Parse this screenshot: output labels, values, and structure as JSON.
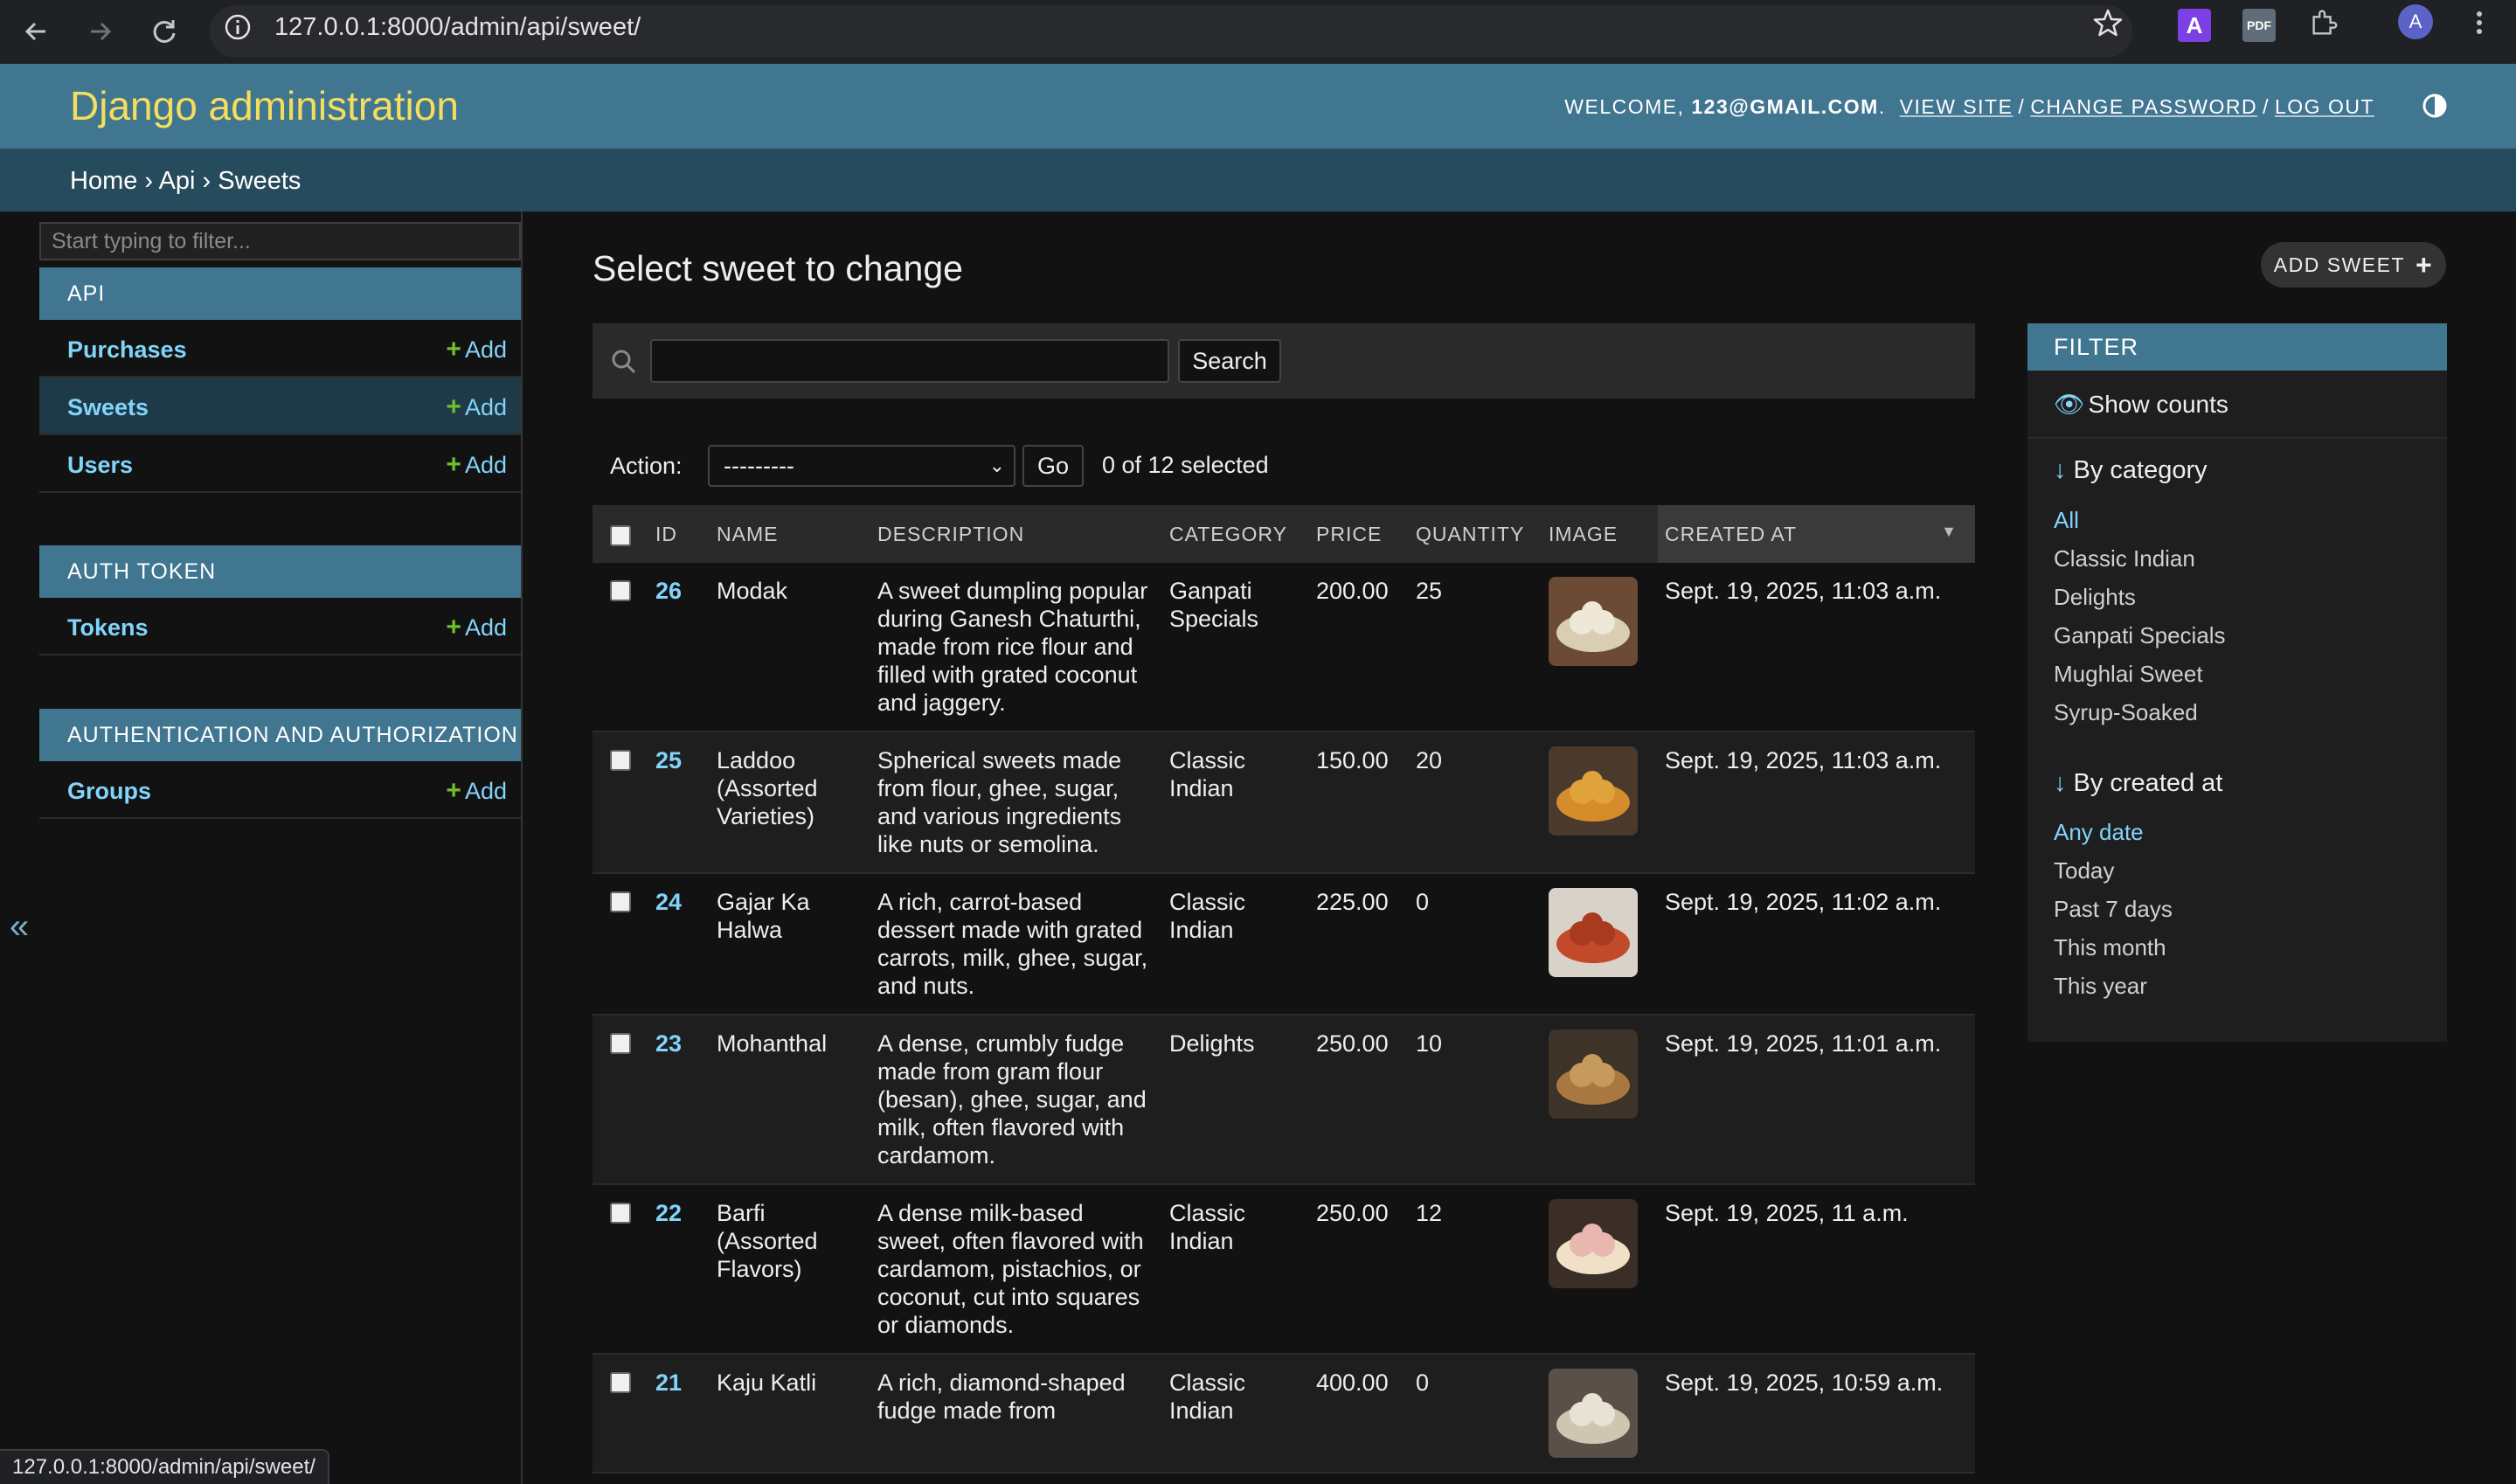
{
  "browser": {
    "url": "127.0.0.1:8000/admin/api/sweet/",
    "avatar_letter": "A",
    "ext_a_label": "A",
    "ext_pdf_label": "PDF",
    "status_url": "127.0.0.1:8000/admin/api/sweet/"
  },
  "header": {
    "site_name": "Django administration",
    "welcome": "WELCOME, ",
    "user": "123@GMAIL.COM",
    "period": ".",
    "view_site": "VIEW SITE",
    "change_password": "CHANGE PASSWORD",
    "log_out": "LOG OUT",
    "separator": "/"
  },
  "breadcrumbs": {
    "home": "Home",
    "app": "Api",
    "current": "Sweets",
    "sep": "›"
  },
  "sidebar": {
    "filter_placeholder": "Start typing to filter...",
    "add_label": "Add",
    "collapse_icon": "«",
    "modules": [
      {
        "caption": "API",
        "models": [
          "Purchases",
          "Sweets",
          "Users"
        ]
      },
      {
        "caption": "AUTH TOKEN",
        "models": [
          "Tokens"
        ]
      },
      {
        "caption": "AUTHENTICATION AND AUTHORIZATION",
        "models": [
          "Groups"
        ]
      }
    ],
    "current_model": "Sweets"
  },
  "content": {
    "title": "Select sweet to change",
    "add_button": "ADD SWEET",
    "search_button": "Search",
    "action_label": "Action:",
    "action_selected": "---------",
    "go_button": "Go",
    "selected_count": "0 of 12 selected",
    "columns": [
      "ID",
      "NAME",
      "DESCRIPTION",
      "CATEGORY",
      "PRICE",
      "QUANTITY",
      "IMAGE",
      "CREATED AT"
    ],
    "rows": [
      {
        "id": "26",
        "name": "Modak",
        "description": "A sweet dumpling popular during Ganesh Chaturthi, made from rice flour and filled with grated coconut and jaggery.",
        "category": "Ganpati Specials",
        "price": "200.00",
        "quantity": "25",
        "created_at": "Sept. 19, 2025, 11:03 a.m."
      },
      {
        "id": "25",
        "name": "Laddoo (Assorted Varieties)",
        "description": "Spherical sweets made from flour, ghee, sugar, and various ingredients like nuts or semolina.",
        "category": "Classic Indian",
        "price": "150.00",
        "quantity": "20",
        "created_at": "Sept. 19, 2025, 11:03 a.m."
      },
      {
        "id": "24",
        "name": "Gajar Ka Halwa",
        "description": "A rich, carrot-based dessert made with grated carrots, milk, ghee, sugar, and nuts.",
        "category": "Classic Indian",
        "price": "225.00",
        "quantity": "0",
        "created_at": "Sept. 19, 2025, 11:02 a.m."
      },
      {
        "id": "23",
        "name": "Mohanthal",
        "description": "A dense, crumbly fudge made from gram flour (besan), ghee, sugar, and milk, often flavored with cardamom.",
        "category": "Delights",
        "price": "250.00",
        "quantity": "10",
        "created_at": "Sept. 19, 2025, 11:01 a.m."
      },
      {
        "id": "22",
        "name": "Barfi (Assorted Flavors)",
        "description": "A dense milk-based sweet, often flavored with cardamom, pistachios, or coconut, cut into squares or diamonds.",
        "category": "Classic Indian",
        "price": "250.00",
        "quantity": "12",
        "created_at": "Sept. 19, 2025, 11 a.m."
      },
      {
        "id": "21",
        "name": "Kaju Katli",
        "description": "A rich, diamond-shaped fudge made from",
        "category": "Classic Indian",
        "price": "400.00",
        "quantity": "0",
        "created_at": "Sept. 19, 2025, 10:59 a.m."
      }
    ]
  },
  "filter": {
    "caption": "FILTER",
    "show_counts": "Show counts",
    "by_category": "By category",
    "category_choices": [
      "All",
      "Classic Indian",
      "Delights",
      "Ganpati Specials",
      "Mughlai Sweet",
      "Syrup-Soaked"
    ],
    "by_created_at": "By created at",
    "date_choices": [
      "Any date",
      "Today",
      "Past 7 days",
      "This month",
      "This year"
    ]
  },
  "colors": {
    "header": "#417690",
    "breadcrumbs": "#264b5d",
    "site_name": "#f5dd5d",
    "link": "#81d4fa",
    "add_plus": "#70bf2b"
  },
  "icons": [
    "back-arrow-icon",
    "forward-arrow-icon",
    "reload-icon",
    "site-info-icon",
    "star-icon",
    "extension-icon",
    "menu-icon",
    "theme-toggle-icon",
    "search-icon",
    "eye-icon",
    "arrow-down-icon",
    "plus-icon"
  ]
}
